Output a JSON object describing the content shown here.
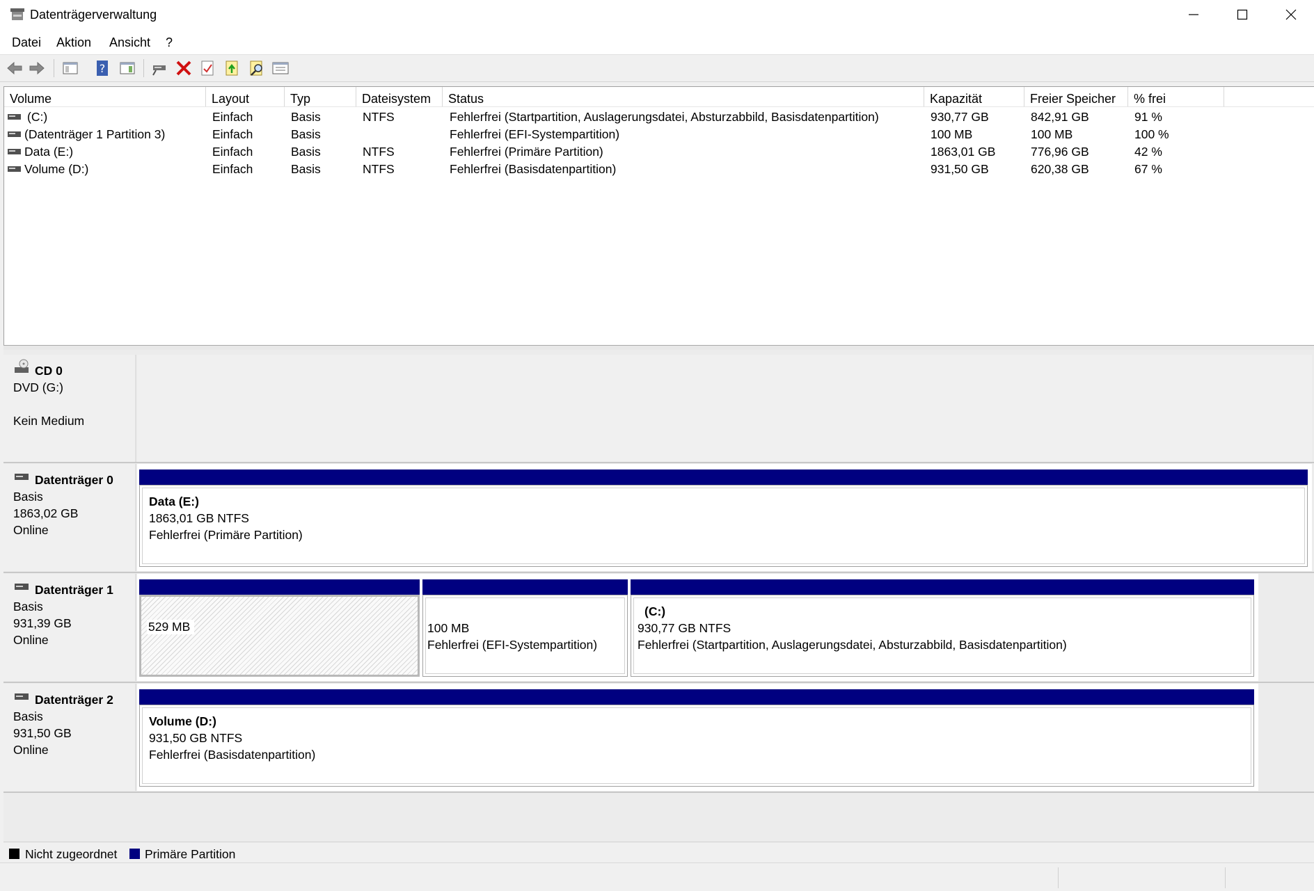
{
  "window": {
    "title": "Datenträgerverwaltung"
  },
  "menu": [
    "Datei",
    "Aktion",
    "Ansicht",
    "?"
  ],
  "toolbar": [
    "back-icon",
    "forward-icon",
    "console-tree-icon",
    "help-icon",
    "action-pane-icon",
    "connect-drive-icon",
    "delete-icon",
    "check-icon",
    "import-icon",
    "search-icon",
    "properties-icon"
  ],
  "list": {
    "columns": [
      "Volume",
      "Layout",
      "Typ",
      "Dateisystem",
      "Status",
      "Kapazität",
      "Freier Speicher",
      "% frei"
    ],
    "rows": [
      [
        "(C:)",
        "Einfach",
        "Basis",
        "NTFS",
        "Fehlerfrei (Startpartition, Auslagerungsdatei, Absturzabbild, Basisdatenpartition)",
        "930,77 GB",
        "842,91 GB",
        "91 %"
      ],
      [
        "(Datenträger 1 Partition 3)",
        "Einfach",
        "Basis",
        "",
        "Fehlerfrei (EFI-Systempartition)",
        "100 MB",
        "100 MB",
        "100 %"
      ],
      [
        "Data (E:)",
        "Einfach",
        "Basis",
        "NTFS",
        "Fehlerfrei (Primäre Partition)",
        "1863,01 GB",
        "776,96 GB",
        "42 %"
      ],
      [
        "Volume (D:)",
        "Einfach",
        "Basis",
        "NTFS",
        "Fehlerfrei (Basisdatenpartition)",
        "931,50 GB",
        "620,38 GB",
        "67 %"
      ]
    ]
  },
  "disks": {
    "cd0": {
      "name": "CD 0",
      "line1": "DVD (G:)",
      "line2": "Kein Medium"
    },
    "d0": {
      "name": "Datenträger 0",
      "type": "Basis",
      "size": "1863,02 GB",
      "status": "Online",
      "p1": {
        "title": "Data  (E:)",
        "size": "1863,01 GB NTFS",
        "status": "Fehlerfrei (Primäre Partition)"
      }
    },
    "d1": {
      "name": "Datenträger 1",
      "type": "Basis",
      "size": "931,39 GB",
      "status": "Online",
      "p1": {
        "size": "529 MB"
      },
      "p2": {
        "size": "100 MB",
        "status": "Fehlerfrei (EFI-Systempartition)"
      },
      "p3": {
        "title": "(C:)",
        "size": "930,77 GB NTFS",
        "status": "Fehlerfrei (Startpartition, Auslagerungsdatei, Absturzabbild, Basisdatenpartition)"
      }
    },
    "d2": {
      "name": "Datenträger 2",
      "type": "Basis",
      "size": "931,50 GB",
      "status": "Online",
      "p1": {
        "title": "Volume  (D:)",
        "size": "931,50 GB NTFS",
        "status": "Fehlerfrei (Basisdatenpartition)"
      }
    }
  },
  "legend": {
    "unallocated": {
      "label": "Nicht zugeordnet",
      "color": "#000000"
    },
    "primary": {
      "label": "Primäre Partition",
      "color": "#000080"
    }
  }
}
